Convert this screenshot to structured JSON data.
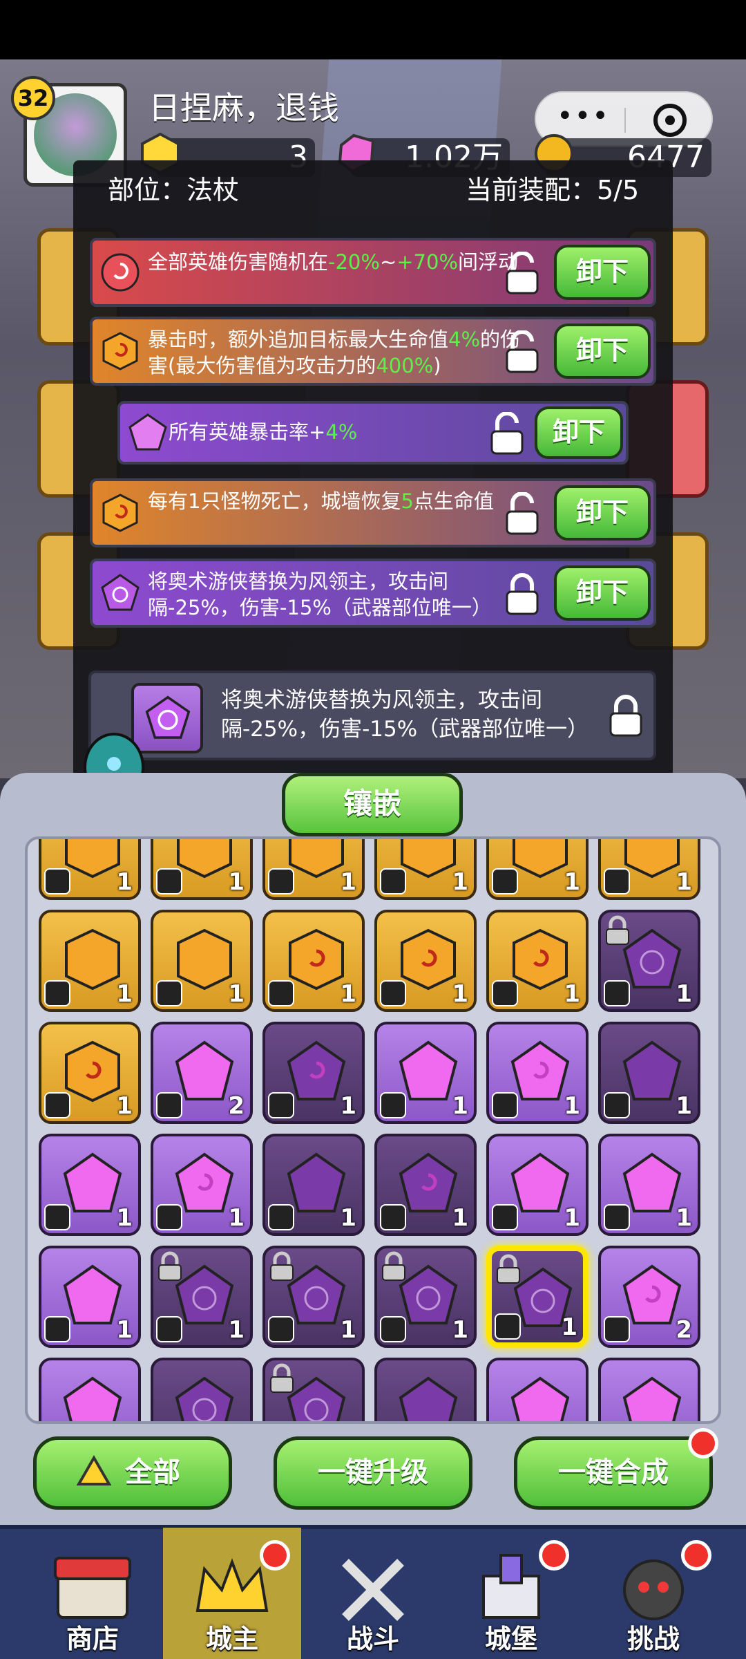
{
  "header": {
    "level": "32",
    "player_name": "日捏麻，退钱",
    "resources": [
      {
        "icon": "gold-gem-icon",
        "value": "3"
      },
      {
        "icon": "pink-diamond-icon",
        "value": "1.02万"
      },
      {
        "icon": "coin-icon",
        "value": "6477"
      }
    ]
  },
  "modal": {
    "slot_label": "部位：法杖",
    "equip_count": "当前装配：5/5",
    "gems": [
      {
        "color": "red",
        "text": "全部英雄伤害随机在",
        "hl1": "-20%",
        "mid": "~",
        "hl2": "+70%",
        "tail": "间浮动",
        "locked": false,
        "button": "卸下"
      },
      {
        "color": "orange",
        "text": "暴击时，额外追加目标最大生命值",
        "hl1": "4%",
        "mid": "的伤害(最大伤害值为攻击力的",
        "hl2": "400%",
        "tail": ")",
        "locked": false,
        "button": "卸下"
      },
      {
        "color": "purple",
        "text": "所有英雄暴击率+",
        "hl1": "4%",
        "mid": "",
        "hl2": "",
        "tail": "",
        "locked": false,
        "button": "卸下"
      },
      {
        "color": "orange",
        "text": "每有1只怪物死亡，城墙恢复",
        "hl1": "5",
        "mid": "点生命值",
        "hl2": "",
        "tail": "",
        "locked": false,
        "button": "卸下"
      },
      {
        "color": "purple",
        "text": "将奥术游侠替换为风领主，攻击间隔-25%，伤害-15%（武器部位唯一）",
        "hl1": "",
        "mid": "",
        "hl2": "",
        "tail": "",
        "locked": true,
        "button": "卸下"
      }
    ],
    "selected_gem": {
      "text": "将奥术游侠替换为风领主，攻击间隔-25%，伤害-15%（武器部位唯一）",
      "locked": true
    },
    "inlay_button": "镶嵌"
  },
  "inventory": {
    "rows": [
      [
        {
          "k": "gold",
          "t": "armor",
          "c": "1"
        },
        {
          "k": "gold",
          "t": "armor",
          "c": "1"
        },
        {
          "k": "gold",
          "t": "armor",
          "c": "1"
        },
        {
          "k": "gold",
          "t": "boot",
          "c": "1"
        },
        {
          "k": "gold",
          "t": "boot",
          "c": "1"
        },
        {
          "k": "gold",
          "t": "boot",
          "c": "1"
        }
      ],
      [
        {
          "k": "gold",
          "t": "boot",
          "c": "1",
          "g": "plain"
        },
        {
          "k": "gold",
          "t": "staff",
          "c": "1",
          "g": "plain"
        },
        {
          "k": "gold",
          "t": "staff",
          "c": "1",
          "g": "swirl"
        },
        {
          "k": "gold",
          "t": "staff",
          "c": "1",
          "g": "swirl"
        },
        {
          "k": "gold",
          "t": "ring",
          "c": "1",
          "g": "swirl"
        },
        {
          "k": "dark",
          "t": "ring",
          "c": "1",
          "g": "rune",
          "lock": true
        }
      ],
      [
        {
          "k": "gold",
          "t": "ring",
          "c": "1",
          "g": "swirl"
        },
        {
          "k": "purp",
          "t": "crown",
          "c": "2",
          "g": "plain"
        },
        {
          "k": "dark",
          "t": "crown",
          "c": "1",
          "g": "swirl"
        },
        {
          "k": "purp",
          "t": "crown",
          "c": "1",
          "g": "plain"
        },
        {
          "k": "purp",
          "t": "crown",
          "c": "1",
          "g": "swirl"
        },
        {
          "k": "dark",
          "t": "armor",
          "c": "1",
          "g": "plain"
        }
      ],
      [
        {
          "k": "purp",
          "t": "armor",
          "c": "1",
          "g": "plain"
        },
        {
          "k": "purp",
          "t": "armor",
          "c": "1",
          "g": "swirl"
        },
        {
          "k": "dark",
          "t": "boot",
          "c": "1",
          "g": "plain"
        },
        {
          "k": "dark",
          "t": "boot",
          "c": "1",
          "g": "swirl"
        },
        {
          "k": "purp",
          "t": "boot",
          "c": "1",
          "g": "plain"
        },
        {
          "k": "purp",
          "t": "boot",
          "c": "1",
          "g": "plain"
        }
      ],
      [
        {
          "k": "purp",
          "t": "staff",
          "c": "1",
          "g": "plain"
        },
        {
          "k": "dark",
          "t": "staff",
          "c": "1",
          "g": "rune",
          "lock": true
        },
        {
          "k": "dark",
          "t": "staff",
          "c": "1",
          "g": "rune",
          "lock": true
        },
        {
          "k": "dark",
          "t": "staff",
          "c": "1",
          "g": "rune",
          "lock": true
        },
        {
          "k": "dark",
          "t": "staff",
          "c": "1",
          "g": "rune",
          "lock": true,
          "sel": true
        },
        {
          "k": "purp",
          "t": "ring",
          "c": "2",
          "g": "swirl"
        }
      ],
      [
        {
          "k": "purp",
          "t": "",
          "c": "",
          "g": "plain"
        },
        {
          "k": "dark",
          "t": "",
          "c": "",
          "g": "rune"
        },
        {
          "k": "dark",
          "t": "",
          "c": "",
          "g": "rune",
          "lock": true
        },
        {
          "k": "dark",
          "t": "",
          "c": "",
          "g": "plain"
        },
        {
          "k": "purp",
          "t": "",
          "c": "",
          "g": "plain"
        },
        {
          "k": "purp",
          "t": "",
          "c": "",
          "g": "plain"
        }
      ]
    ]
  },
  "actions": {
    "all_label": "全部",
    "upgrade_label": "一键升级",
    "merge_label": "一键合成"
  },
  "nav": [
    {
      "label": "商店",
      "icon": "shop-icon",
      "active": false,
      "dot": false
    },
    {
      "label": "城主",
      "icon": "crown-icon",
      "active": true,
      "dot": true
    },
    {
      "label": "战斗",
      "icon": "crossed-swords-icon",
      "active": false,
      "dot": false
    },
    {
      "label": "城堡",
      "icon": "castle-icon",
      "active": false,
      "dot": true
    },
    {
      "label": "挑战",
      "icon": "demon-icon",
      "active": false,
      "dot": true
    }
  ],
  "colors": {
    "highlight_green": "#5ef04a",
    "button_green": "#50bf3a",
    "selected_yellow": "#ffe600",
    "nav_bg": "#2b3a6a"
  }
}
